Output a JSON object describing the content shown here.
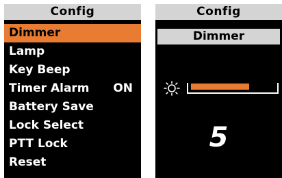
{
  "left_screen": {
    "title": "Config",
    "menu_items": [
      {
        "label": "Dimmer",
        "value": ""
      },
      {
        "label": "Lamp",
        "value": ""
      },
      {
        "label": "Key Beep",
        "value": ""
      },
      {
        "label": "Timer Alarm",
        "value": "ON"
      },
      {
        "label": "Battery Save",
        "value": ""
      },
      {
        "label": "Lock Select",
        "value": ""
      },
      {
        "label": "PTT Lock",
        "value": ""
      },
      {
        "label": "Reset",
        "value": ""
      }
    ],
    "selected_index": 0
  },
  "right_screen": {
    "title": "Config",
    "subtitle": "Dimmer",
    "brightness_icon": "sun-icon",
    "level": "5",
    "slider_fill_fraction": 0.7
  },
  "colors": {
    "accent": "#e87c32",
    "title_bar": "#d4d4d4",
    "background": "#000000"
  }
}
